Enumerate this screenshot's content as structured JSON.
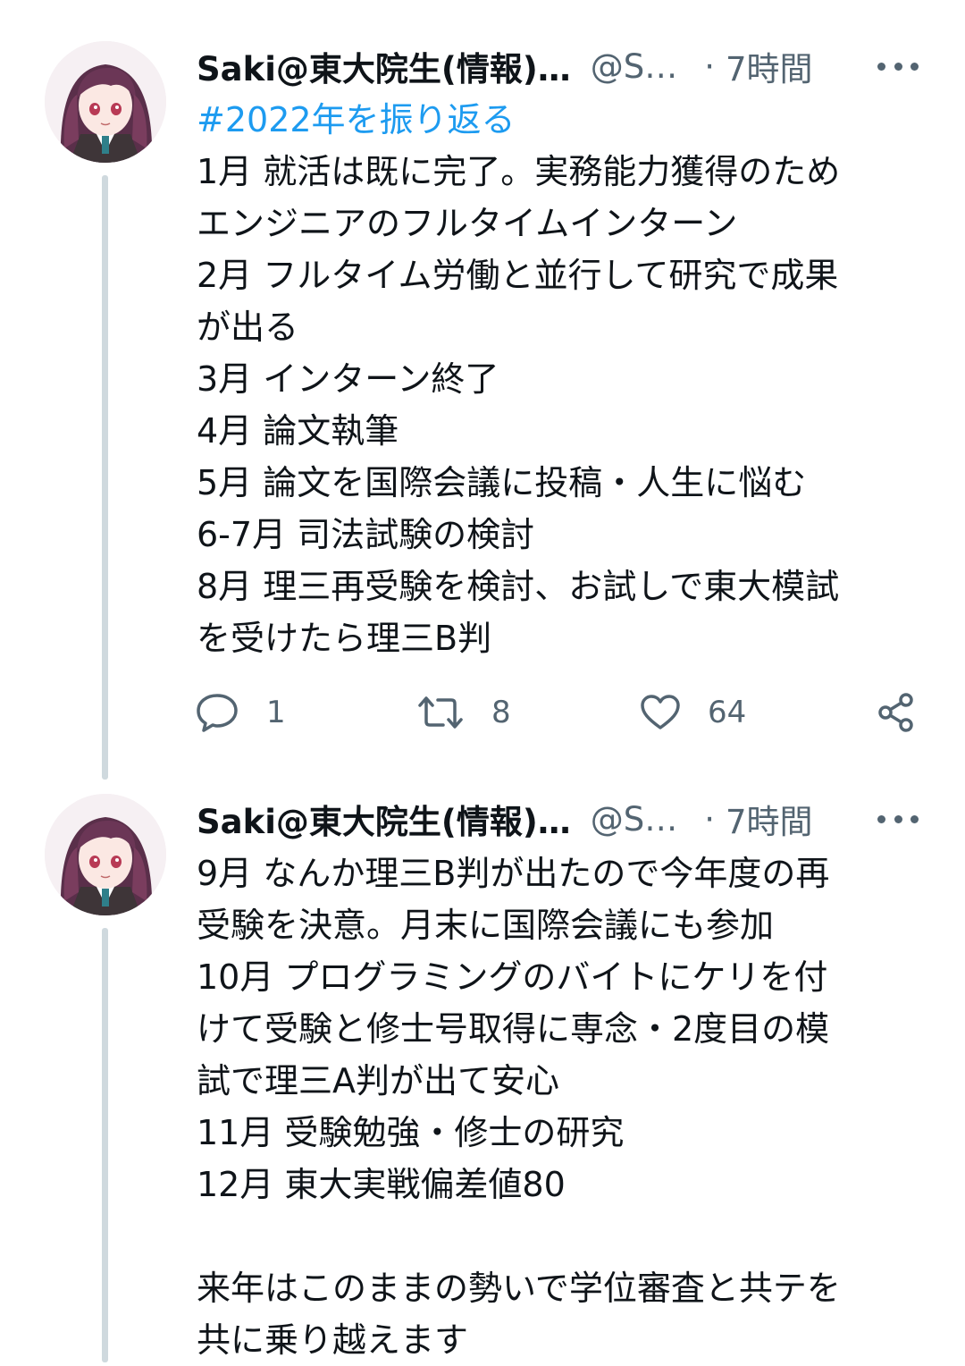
{
  "tweets": [
    {
      "author_name": "Saki@東大院生(情報)…",
      "handle": "@S…",
      "separator": "·",
      "time": "7時間",
      "lines": [
        {
          "text": "#2022年を振り返る",
          "type": "hashtag"
        },
        {
          "text": "1月 就活は既に完了。実務能力獲得のため"
        },
        {
          "text": "エンジニアのフルタイムインターン"
        },
        {
          "text": "2月 フルタイム労働と並行して研究で成果"
        },
        {
          "text": "が出る"
        },
        {
          "text": "3月 インターン終了"
        },
        {
          "text": "4月 論文執筆"
        },
        {
          "text": "5月 論文を国際会議に投稿・人生に悩む"
        },
        {
          "text": "6-7月 司法試験の検討"
        },
        {
          "text": "8月 理三再受験を検討、お試しで東大模試"
        },
        {
          "text": "を受けたら理三B判"
        }
      ],
      "actions": {
        "replies": "1",
        "retweets": "8",
        "likes": "64"
      }
    },
    {
      "author_name": "Saki@東大院生(情報)…",
      "handle": "@S…",
      "separator": "·",
      "time": "7時間",
      "lines": [
        {
          "text": "9月 なんか理三B判が出たので今年度の再"
        },
        {
          "text": "受験を決意。月末に国際会議にも参加"
        },
        {
          "text": "10月 プログラミングのバイトにケリを付"
        },
        {
          "text": "けて受験と修士号取得に専念・2度目の模"
        },
        {
          "text": "試で理三A判が出て安心"
        },
        {
          "text": "11月 受験勉強・修士の研究"
        },
        {
          "text": "12月 東大実戦偏差値80"
        },
        {
          "text": ""
        },
        {
          "text": "来年はこのままの勢いで学位審査と共テを"
        },
        {
          "text": "共に乗り越えます"
        }
      ]
    }
  ],
  "icons": {
    "avatar": "anime-girl-avatar",
    "more": "more-dots-icon",
    "reply": "reply-icon",
    "retweet": "retweet-icon",
    "like": "heart-icon",
    "share": "share-icon"
  },
  "colors": {
    "text": "#0f1419",
    "muted": "#536471",
    "hashtag": "#1d9bf0",
    "thread_line": "#cfd9de"
  }
}
